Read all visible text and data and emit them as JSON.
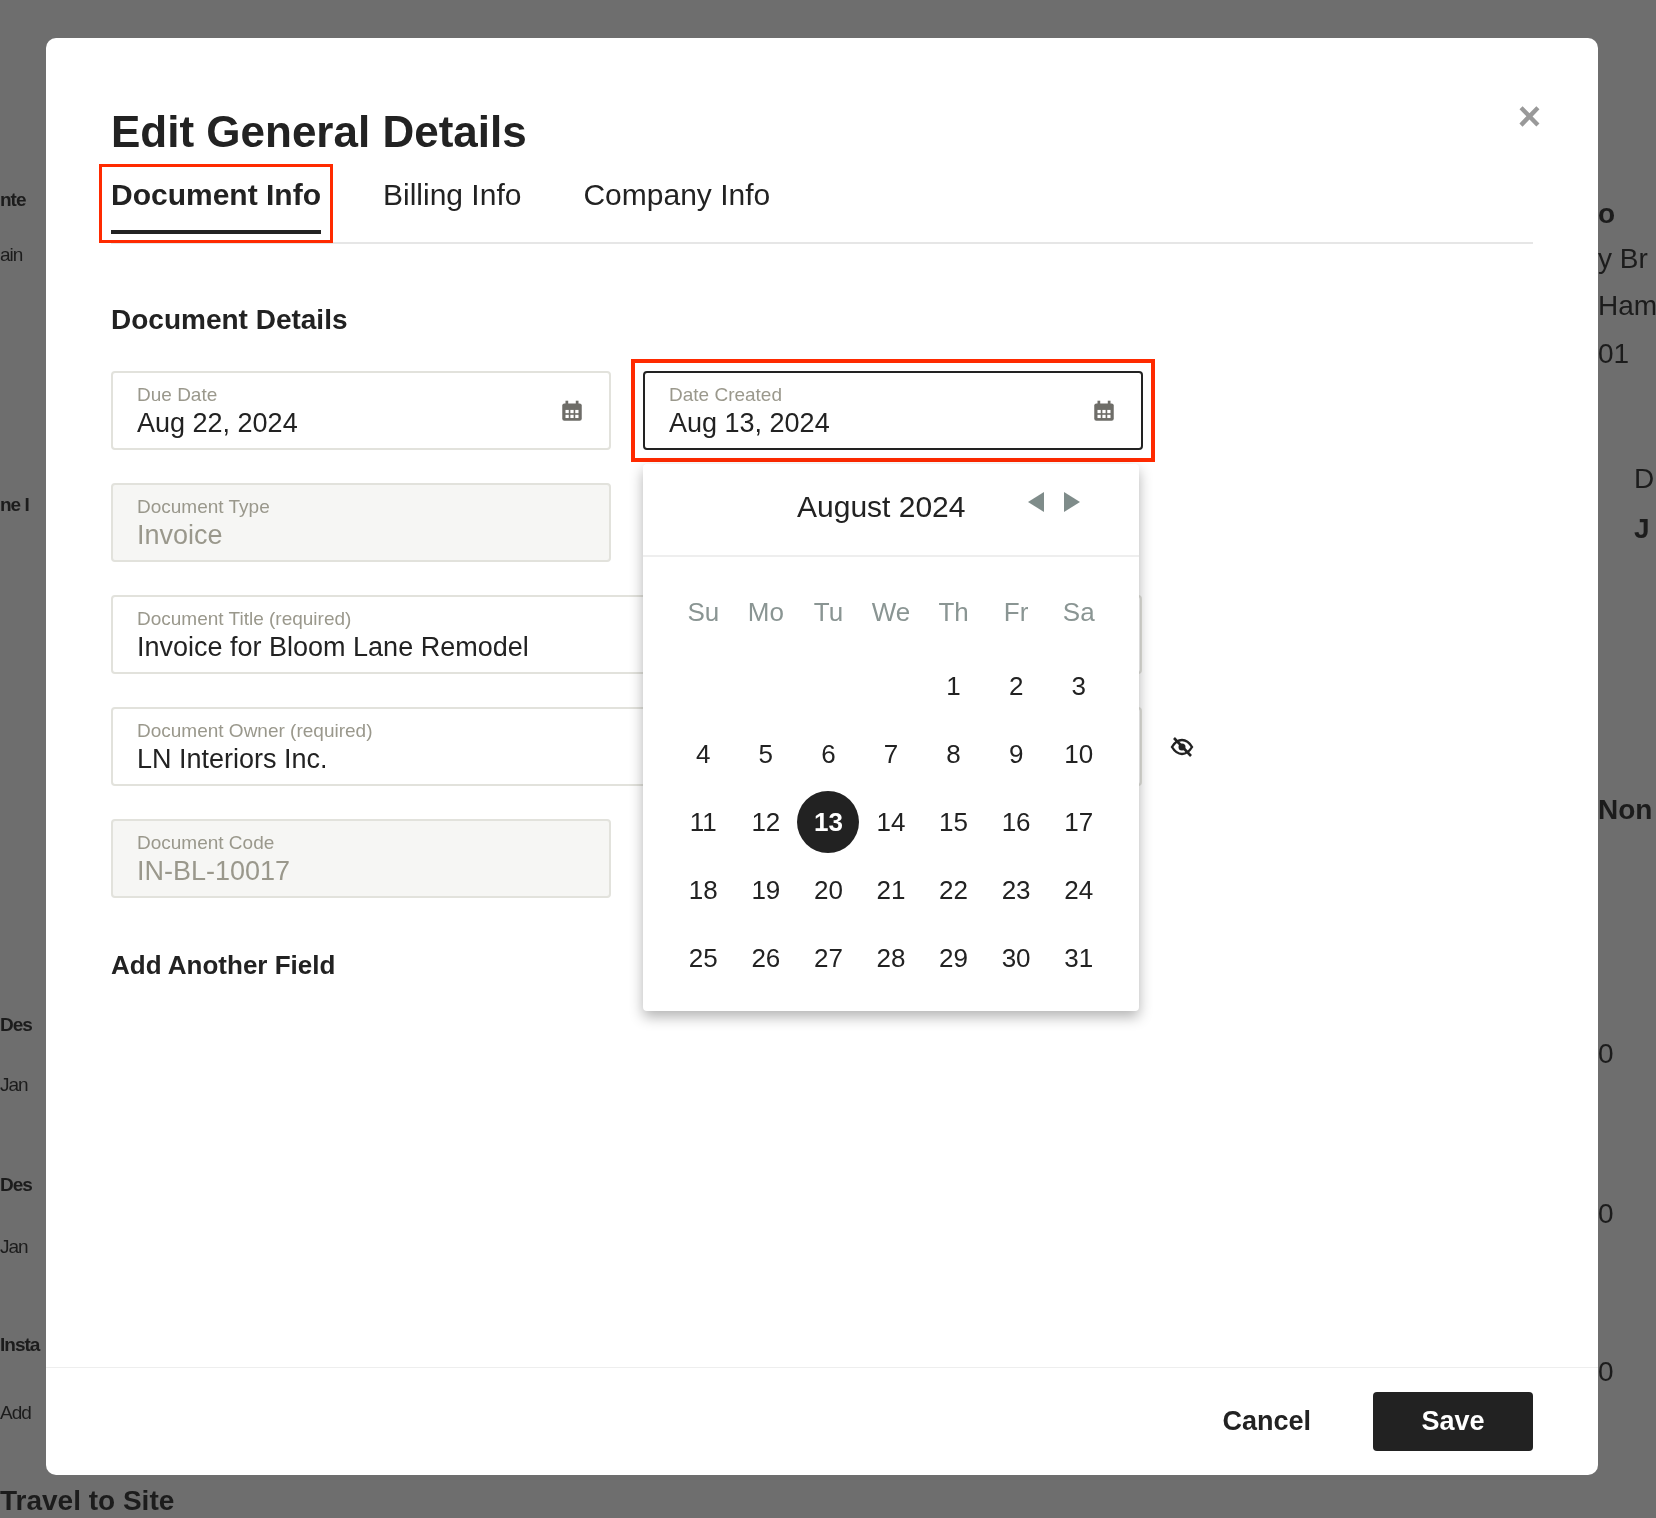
{
  "background": {
    "left_texts": [
      "nte",
      "ain",
      "ne I",
      "Des",
      "Jan",
      "Des",
      "Jan",
      "Insta",
      "Add",
      "Travel to Site"
    ],
    "right_texts": [
      "o",
      "y Br",
      "Ham",
      "01",
      "D",
      "J",
      "Non",
      "0",
      "0",
      "0"
    ]
  },
  "dialog": {
    "title": "Edit General Details",
    "close": "×",
    "tabs": [
      {
        "label": "Document Info",
        "selected": true,
        "highlighted": true
      },
      {
        "label": "Billing Info",
        "selected": false,
        "highlighted": false
      },
      {
        "label": "Company Info",
        "selected": false,
        "highlighted": false
      }
    ],
    "section_heading": "Document Details",
    "fields": [
      {
        "kind": "date",
        "label": "Due Date",
        "value": "Aug 22, 2024",
        "disabled": false,
        "highlighted": false,
        "focused": false
      },
      {
        "kind": "date",
        "label": "Date Created",
        "value": "Aug 13, 2024",
        "disabled": false,
        "highlighted": true,
        "focused": true
      },
      {
        "kind": "text",
        "label": "Document Type",
        "value": "Invoice",
        "disabled": true,
        "highlighted": false,
        "focused": false
      },
      {
        "kind": "wide",
        "label": "Document Title (required)",
        "value": "Invoice for Bloom Lane Remodel",
        "disabled": false,
        "highlighted": false,
        "focused": false
      },
      {
        "kind": "wide_hidden",
        "label": "Document Owner (required)",
        "value": "LN Interiors Inc.",
        "disabled": false,
        "highlighted": false,
        "focused": false
      },
      {
        "kind": "text",
        "label": "Document Code",
        "value": "IN-BL-10017",
        "disabled": true,
        "highlighted": false,
        "focused": false
      }
    ],
    "add_field": "Add Another Field",
    "calendar": {
      "month": "August 2024",
      "weekdays": [
        "Su",
        "Mo",
        "Tu",
        "We",
        "Th",
        "Fr",
        "Sa"
      ],
      "weeks": [
        [
          {
            "label": "1",
            "selected": false
          },
          {
            "label": "2",
            "selected": false
          },
          {
            "label": "3",
            "selected": false
          }
        ],
        [
          {
            "label": "4",
            "selected": false
          },
          {
            "label": "5",
            "selected": false
          },
          {
            "label": "6",
            "selected": false
          },
          {
            "label": "7",
            "selected": false
          },
          {
            "label": "8",
            "selected": false
          },
          {
            "label": "9",
            "selected": false
          },
          {
            "label": "10",
            "selected": false
          }
        ],
        [
          {
            "label": "11",
            "selected": false
          },
          {
            "label": "12",
            "selected": false
          },
          {
            "label": "13",
            "selected": true
          },
          {
            "label": "14",
            "selected": false
          },
          {
            "label": "15",
            "selected": false
          },
          {
            "label": "16",
            "selected": false
          },
          {
            "label": "17",
            "selected": false
          }
        ],
        [
          {
            "label": "18",
            "selected": false
          },
          {
            "label": "19",
            "selected": false
          },
          {
            "label": "20",
            "selected": false
          },
          {
            "label": "21",
            "selected": false
          },
          {
            "label": "22",
            "selected": false
          },
          {
            "label": "23",
            "selected": false
          },
          {
            "label": "24",
            "selected": false
          }
        ],
        [
          {
            "label": "25",
            "selected": false
          },
          {
            "label": "26",
            "selected": false
          },
          {
            "label": "27",
            "selected": false
          },
          {
            "label": "28",
            "selected": false
          },
          {
            "label": "29",
            "selected": false
          },
          {
            "label": "30",
            "selected": false
          },
          {
            "label": "31",
            "selected": false
          }
        ]
      ]
    },
    "buttons": [
      {
        "kind": "secondary",
        "label": "Cancel"
      },
      {
        "kind": "primary",
        "label": "Save"
      }
    ]
  }
}
